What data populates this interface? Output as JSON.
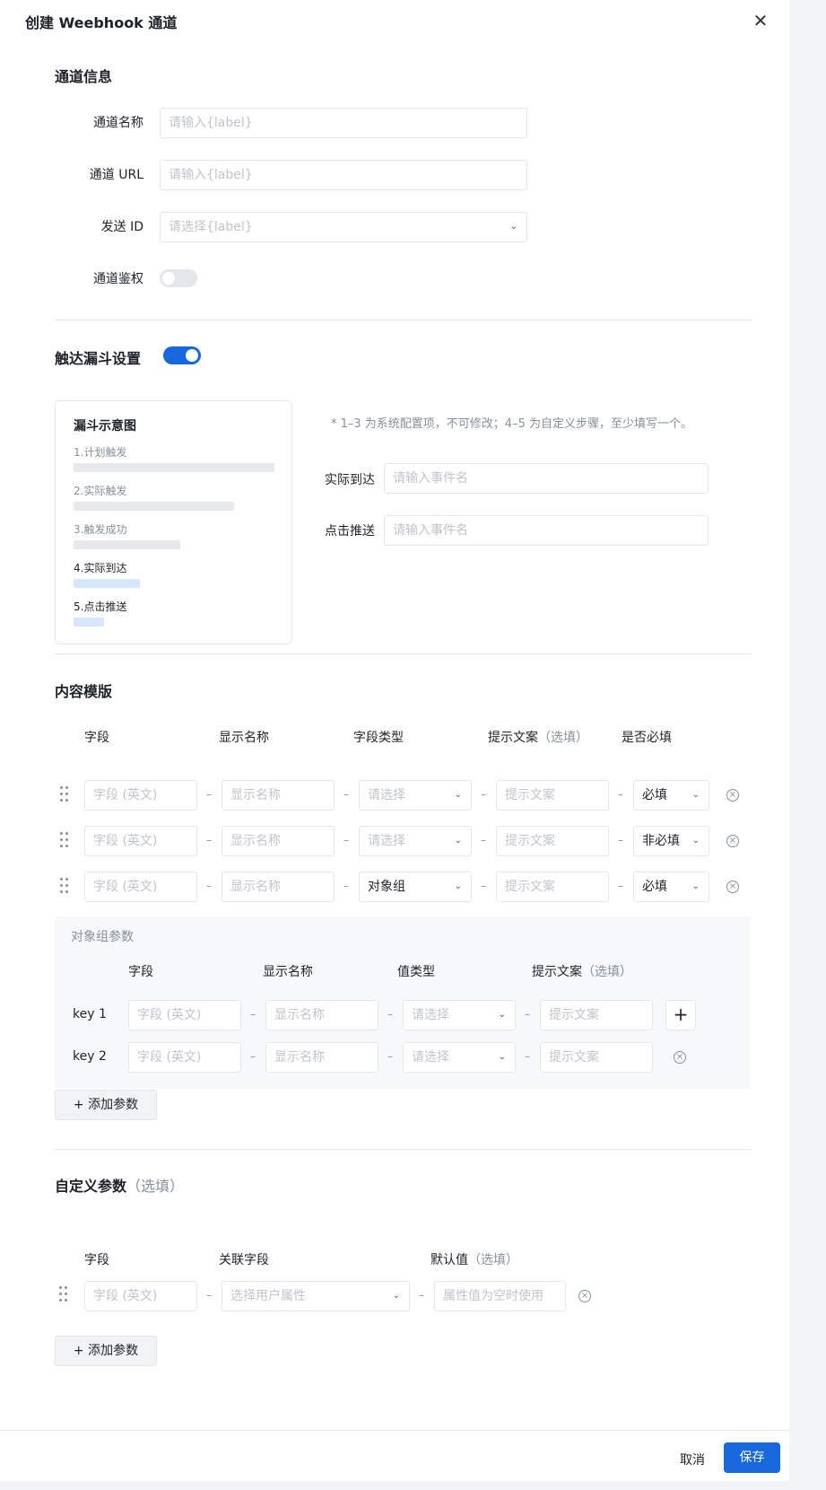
{
  "header": {
    "title": "创建 Weebhook 通道"
  },
  "channel_info": {
    "title": "通道信息",
    "name_label": "通道名称",
    "name_placeholder": "请输入{label}",
    "url_label": "通道 URL",
    "url_placeholder": "请输入{label}",
    "send_id_label": "发送 ID",
    "send_id_placeholder": "请选择{label}",
    "auth_label": "通道鉴权",
    "auth_enabled": false
  },
  "funnel_settings": {
    "title": "触达漏斗设置",
    "enabled": true,
    "diagram_title": "漏斗示意图",
    "steps": [
      {
        "label": "1.计划触发",
        "fill": 1.0
      },
      {
        "label": "2.实际触发",
        "fill": 0.8
      },
      {
        "label": "3.触发成功",
        "fill": 0.53
      },
      {
        "label": "4.实际到达",
        "fill": 0.33
      },
      {
        "label": "5.点击推送",
        "fill": 0.15
      }
    ],
    "note": "* 1–3 为系统配置项，不可修改；4–5 为自定义步骤，至少填写一个。",
    "actual_reach_label": "实际到达",
    "actual_reach_placeholder": "请输入事件名",
    "click_push_label": "点击推送",
    "click_push_placeholder": "请输入事件名"
  },
  "content_template": {
    "title": "内容模版",
    "columns": {
      "field": "字段",
      "display_name": "显示名称",
      "field_type": "字段类型",
      "hint": "提示文案",
      "hint_optional": "（选填）",
      "required": "是否必填"
    },
    "rows": [
      {
        "field_ph": "字段 (英文)",
        "name_ph": "显示名称",
        "type": "请选择",
        "type_selected": false,
        "hint_ph": "提示文案",
        "required": "必填"
      },
      {
        "field_ph": "字段 (英文)",
        "name_ph": "显示名称",
        "type": "请选择",
        "type_selected": false,
        "hint_ph": "提示文案",
        "required": "非必填"
      },
      {
        "field_ph": "字段 (英文)",
        "name_ph": "显示名称",
        "type": "对象组",
        "type_selected": true,
        "hint_ph": "提示文案",
        "required": "必填"
      }
    ],
    "object_group": {
      "title": "对象组参数",
      "columns": {
        "field": "字段",
        "display_name": "显示名称",
        "value_type": "值类型",
        "hint": "提示文案",
        "hint_optional": "（选填）"
      },
      "rows": [
        {
          "key": "key 1",
          "field_ph": "字段 (英文)",
          "name_ph": "显示名称",
          "type_ph": "请选择",
          "hint_ph": "提示文案"
        },
        {
          "key": "key 2",
          "field_ph": "字段 (英文)",
          "name_ph": "显示名称",
          "type_ph": "请选择",
          "hint_ph": "提示文案"
        }
      ]
    },
    "add_param_label": "添加参数"
  },
  "custom_params": {
    "title": "自定义参数",
    "title_optional": "（选填）",
    "columns": {
      "field": "字段",
      "linked_field": "关联字段",
      "default_value": "默认值",
      "default_optional": "（选填）"
    },
    "row": {
      "field_ph": "字段 (英文)",
      "linked_ph": "选择用户属性",
      "default_ph": "属性值为空时使用"
    },
    "add_param_label": "添加参数"
  },
  "footer": {
    "cancel_label": "取消",
    "save_label": "保存"
  },
  "colors": {
    "primary": "#1668dc",
    "border": "#e5e6eb",
    "placeholder": "#c0c4cc"
  }
}
